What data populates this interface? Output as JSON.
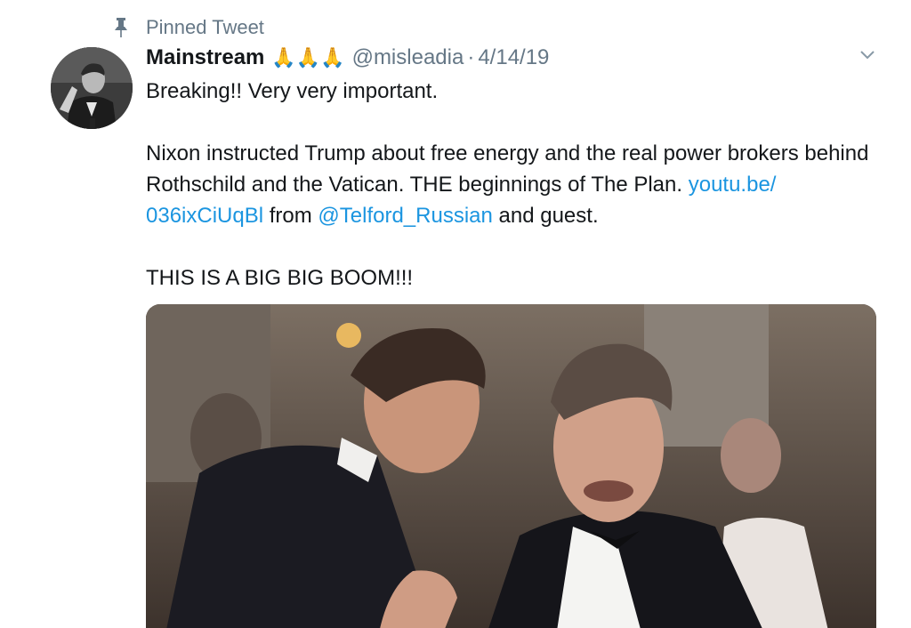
{
  "pinned": {
    "label": "Pinned Tweet"
  },
  "tweet": {
    "display_name": "Mainstream",
    "emoji": "🙏🙏🙏",
    "handle": "@misleadia",
    "separator": "·",
    "date": "4/14/19",
    "text": {
      "line1": "Breaking!! Very very important.",
      "p2_start": "Nixon instructed Trump about free energy and the real power brokers behind Rothschild and the Vatican. THE beginnings of The Plan. ",
      "link_url_part1": "youtu.be/",
      "link_url_part2": "036ixCiUqBl",
      "from_word": " from ",
      "mention": "@Telford_Russian",
      "p2_end": " and guest.",
      "line3": "THIS IS A BIG BIG BOOM!!!"
    }
  },
  "colors": {
    "text": "#14171a",
    "secondary": "#657786",
    "link": "#1b95e0"
  },
  "icons": {
    "pin": "pin-icon",
    "caret": "chevron-down-icon"
  }
}
